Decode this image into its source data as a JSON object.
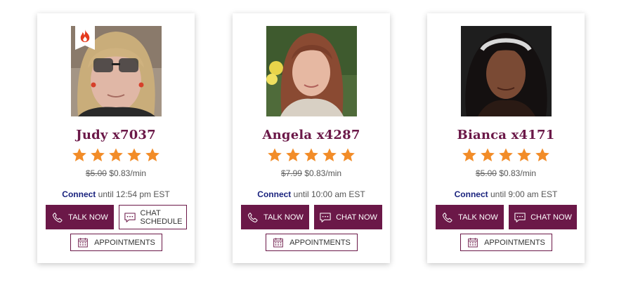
{
  "colors": {
    "brand": "#6b1848",
    "star": "#f28c28",
    "connect_link": "#1a237e"
  },
  "advisors": [
    {
      "name": "Judy x7037",
      "rating": 5,
      "hot_badge_icon": "fire-icon",
      "old_price": "$5.00",
      "price": "$0.83/min",
      "connect_label": "Connect",
      "connect_until": "until 12:54 pm EST",
      "talk_label": "TALK NOW",
      "chat_label_line1": "CHAT",
      "chat_label_line2": "SCHEDULE",
      "appointments_label": "APPOINTMENTS"
    },
    {
      "name": "Angela x4287",
      "rating": 5,
      "old_price": "$7.99",
      "price": "$0.83/min",
      "connect_label": "Connect",
      "connect_until": "until 10:00 am EST",
      "talk_label": "TALK NOW",
      "chat_label": "CHAT NOW",
      "appointments_label": "APPOINTMENTS"
    },
    {
      "name": "Bianca x4171",
      "rating": 5,
      "old_price": "$5.00",
      "price": "$0.83/min",
      "connect_label": "Connect",
      "connect_until": "until 9:00 am EST",
      "talk_label": "TALK NOW",
      "chat_label": "CHAT NOW",
      "appointments_label": "APPOINTMENTS"
    }
  ]
}
